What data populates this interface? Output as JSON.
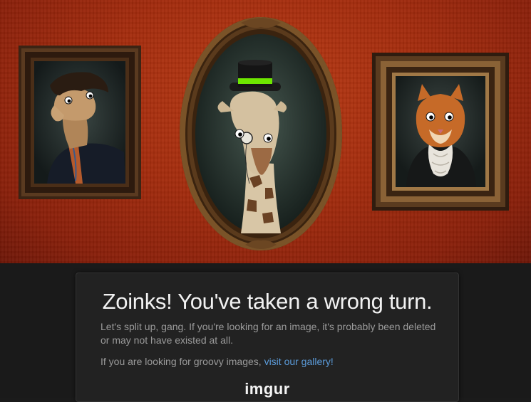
{
  "hero": {
    "portraits": [
      {
        "subject": "horse-portrait"
      },
      {
        "subject": "giraffe-portrait"
      },
      {
        "subject": "cat-portrait"
      }
    ]
  },
  "message": {
    "title": "Zoinks! You've taken a wrong turn.",
    "line1": "Let's split up, gang. If you're looking for an image, it's probably been deleted or may not have existed at all.",
    "line2_prefix": "If you are looking for groovy images, ",
    "line2_link": "visit our gallery!",
    "logo": "imgur"
  },
  "colors": {
    "wall": "#a42c0d",
    "background": "#1a1a1a",
    "link": "#5b9bd9",
    "hat_band": "#6ee600"
  }
}
